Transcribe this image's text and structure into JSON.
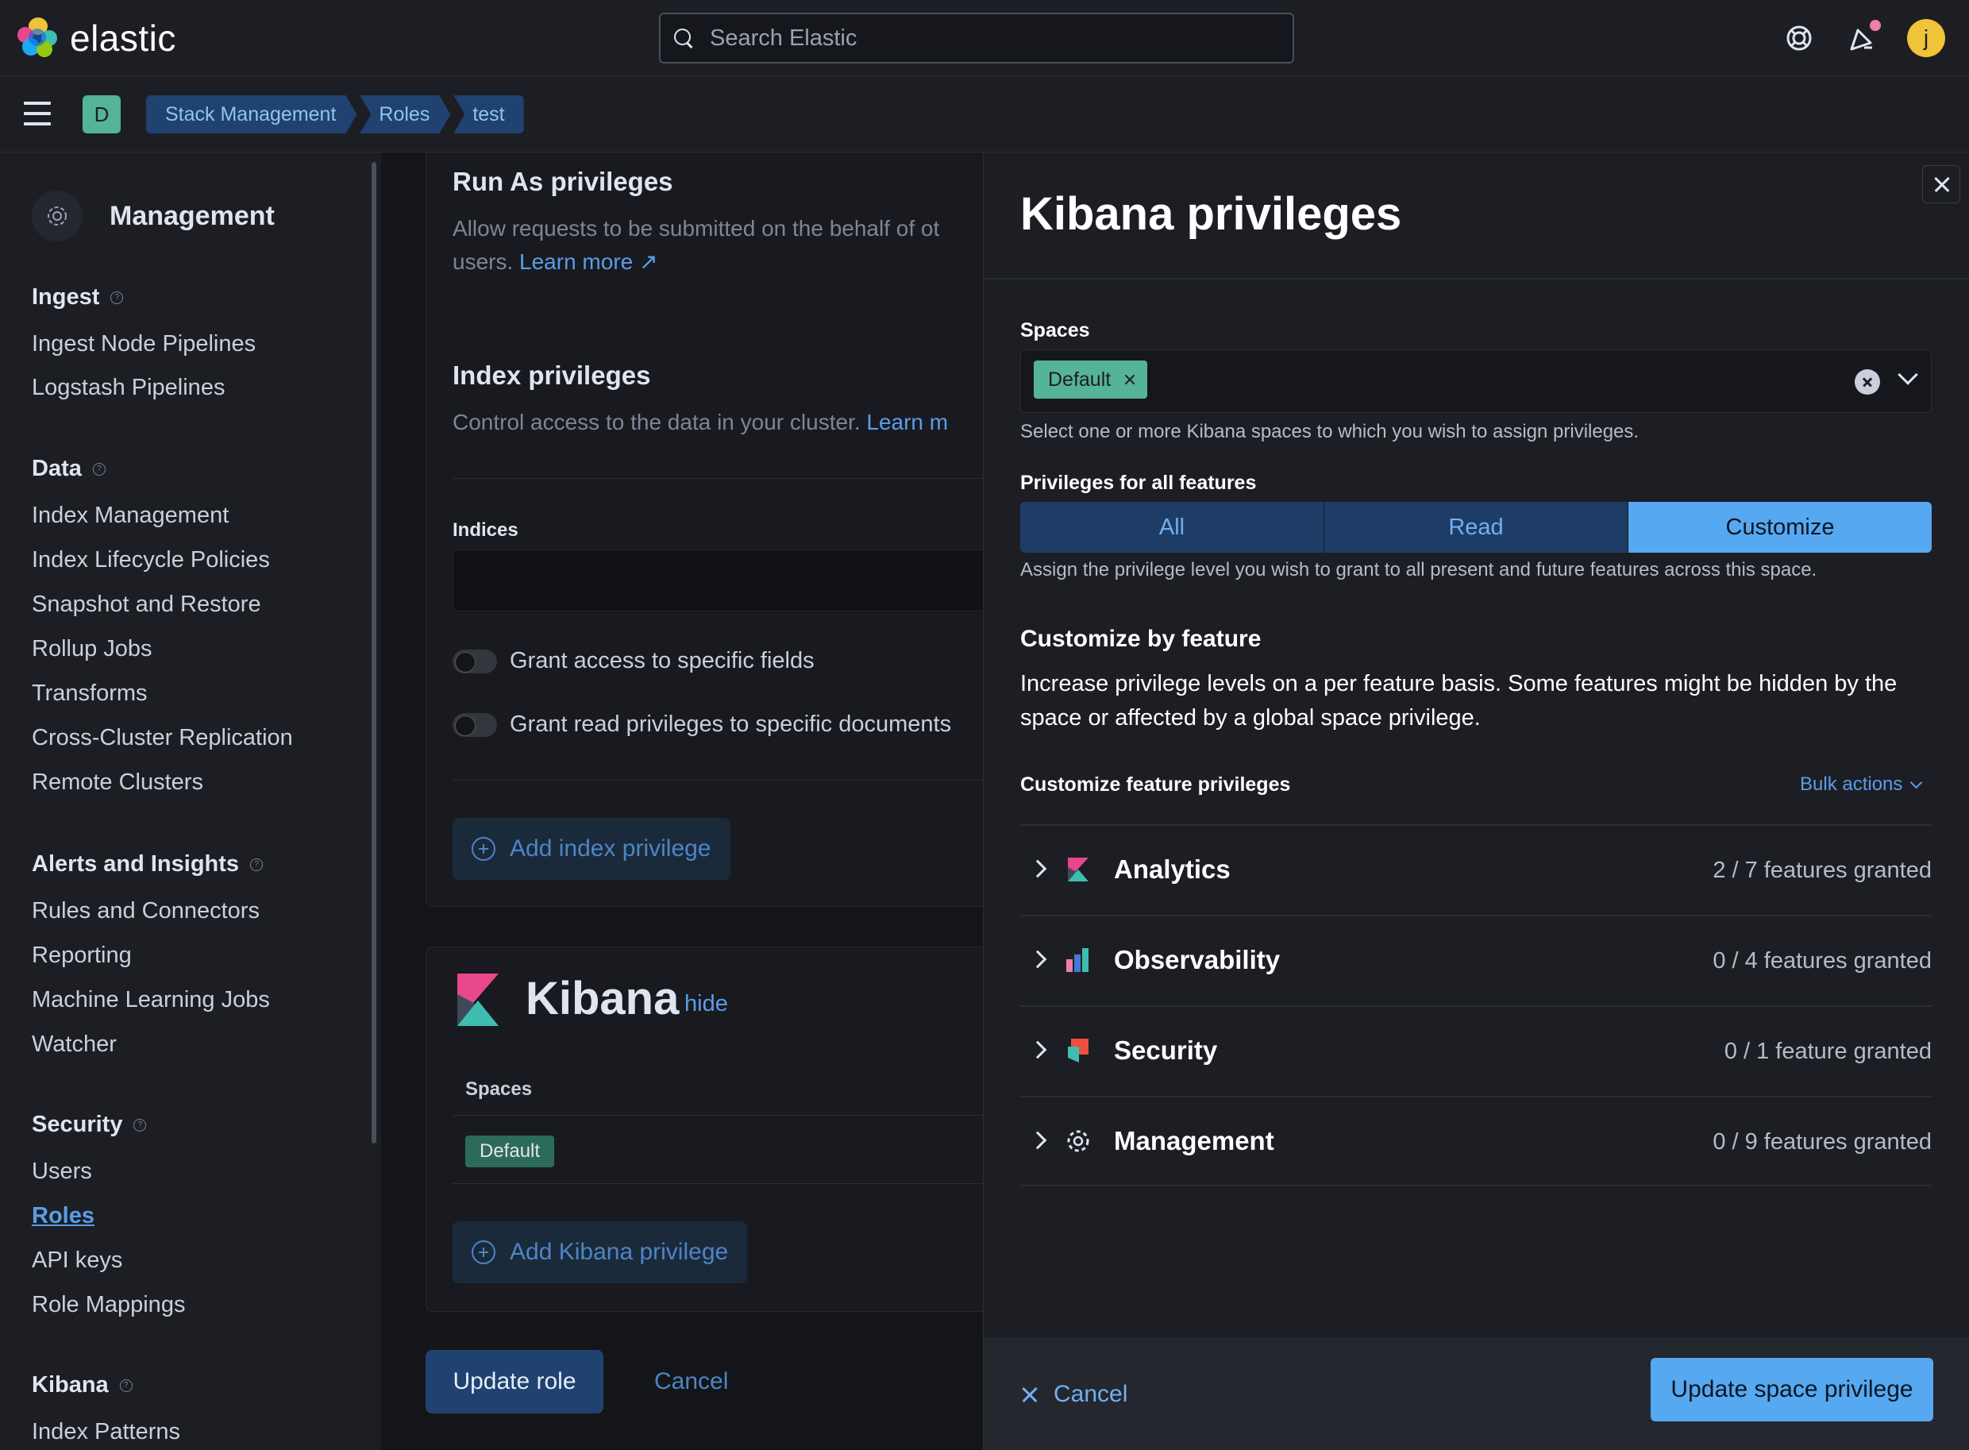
{
  "app": {
    "logo_text": "elastic",
    "search_placeholder": "Search Elastic",
    "avatar_initial": "j",
    "space_initial": "D"
  },
  "breadcrumbs": [
    "Stack Management",
    "Roles",
    "test"
  ],
  "sidebar": {
    "title": "Management",
    "groups": [
      {
        "label": "Ingest",
        "items": [
          "Ingest Node Pipelines",
          "Logstash Pipelines"
        ]
      },
      {
        "label": "Data",
        "items": [
          "Index Management",
          "Index Lifecycle Policies",
          "Snapshot and Restore",
          "Rollup Jobs",
          "Transforms",
          "Cross-Cluster Replication",
          "Remote Clusters"
        ]
      },
      {
        "label": "Alerts and Insights",
        "items": [
          "Rules and Connectors",
          "Reporting",
          "Machine Learning Jobs",
          "Watcher"
        ]
      },
      {
        "label": "Security",
        "items": [
          "Users",
          "Roles",
          "API keys",
          "Role Mappings"
        ]
      },
      {
        "label": "Kibana",
        "items": [
          "Index Patterns"
        ]
      }
    ],
    "active_item": "Roles"
  },
  "main": {
    "run_as_title": "Run As privileges",
    "run_as_desc_line1": "Allow requests to be submitted on the behalf of ot",
    "run_as_desc_line2": "users.",
    "run_as_learn_more": "Learn more",
    "index_title": "Index privileges",
    "index_desc": "Control access to the data in your cluster.",
    "index_learn_more": "Learn m",
    "indices_label": "Indices",
    "toggle_fields": "Grant access to specific fields",
    "toggle_docs": "Grant read privileges to specific documents",
    "add_index_privilege": "Add index privilege",
    "kibana_title": "Kibana",
    "kibana_hide": "hide",
    "spaces_label": "Spaces",
    "default_badge": "Default",
    "add_kibana_privilege": "Add Kibana privilege",
    "update_role": "Update role",
    "cancel": "Cancel"
  },
  "flyout": {
    "title": "Kibana privileges",
    "spaces_label": "Spaces",
    "selected_space": "Default",
    "spaces_help": "Select one or more Kibana spaces to which you wish to assign privileges.",
    "privileges_label": "Privileges for all features",
    "privilege_options": [
      "All",
      "Read",
      "Customize"
    ],
    "privilege_selected": "Customize",
    "privileges_help": "Assign the privilege level you wish to grant to all present and future features across this space.",
    "customize_title": "Customize by feature",
    "customize_desc": "Increase privilege levels on a per feature basis. Some features might be hidden by the space or affected by a global space privilege.",
    "feature_privileges_label": "Customize feature privileges",
    "bulk_actions": "Bulk actions",
    "features": [
      {
        "name": "Analytics",
        "count": "2 / 7 features granted",
        "icon": "kibana-logo-icon"
      },
      {
        "name": "Observability",
        "count": "0 / 4 features granted",
        "icon": "observability-icon"
      },
      {
        "name": "Security",
        "count": "0 / 1 feature granted",
        "icon": "security-solution-icon"
      },
      {
        "name": "Management",
        "count": "0 / 9 features granted",
        "icon": "gear-icon"
      }
    ],
    "cancel": "Cancel",
    "update_button": "Update space privilege"
  },
  "colors": {
    "accent": "#56a8f0",
    "space_badge": "#54b399",
    "avatar": "#f0c338"
  }
}
